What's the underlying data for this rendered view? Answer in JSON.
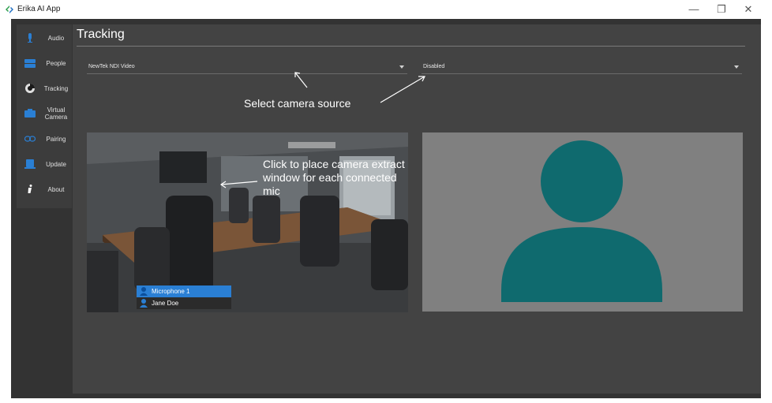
{
  "window": {
    "title": "Erika AI App",
    "minimize_glyph": "—",
    "maximize_glyph": "❐",
    "close_glyph": "✕"
  },
  "sidebar": {
    "items": [
      {
        "label": "Audio",
        "icon": "microphone-icon"
      },
      {
        "label": "People",
        "icon": "people-icon"
      },
      {
        "label": "Tracking",
        "icon": "tracking-icon"
      },
      {
        "label": "Virtual Camera",
        "icon": "camera-icon"
      },
      {
        "label": "Pairing",
        "icon": "link-icon"
      },
      {
        "label": "Update",
        "icon": "update-icon"
      },
      {
        "label": "About",
        "icon": "info-icon"
      }
    ]
  },
  "page": {
    "title": "Tracking",
    "camera_source_select": {
      "value": "NewTek NDI Video"
    },
    "second_source_select": {
      "value": "Disabled"
    },
    "annotation_source": "Select camera source",
    "annotation_place": "Click to place camera extract window for each connected mic",
    "mic_list": [
      {
        "label": "Microphone 1",
        "selected": true
      },
      {
        "label": "Jane Doe",
        "selected": false
      }
    ]
  },
  "colors": {
    "accent": "#2a7fd4",
    "person_placeholder": "#0f6a6e",
    "placeholder_bg": "#808080",
    "background": "#333333"
  }
}
